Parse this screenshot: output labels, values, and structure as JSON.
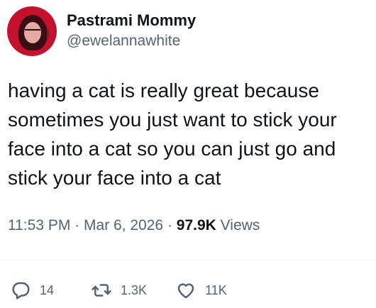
{
  "author": {
    "display_name": "Pastrami Mommy",
    "handle": "@ewelannawhite"
  },
  "tweet": {
    "text": "having a cat is really great because sometimes you just want to stick your face into a cat so you can just go and stick your face into a cat"
  },
  "meta": {
    "time": "11:53 PM",
    "separator": "·",
    "date": "Mar 6, 2026",
    "views_count": "97.9K",
    "views_label": "Views"
  },
  "actions": {
    "replies": "14",
    "retweets": "1.3K",
    "likes": "11K"
  },
  "icons": {
    "reply": "speech-bubble-icon",
    "retweet": "retweet-arrows-icon",
    "like": "heart-icon"
  },
  "colors": {
    "text_primary": "#0f1419",
    "text_secondary": "#536471",
    "divider": "#eff3f4",
    "avatar_background": "#c4122e"
  }
}
